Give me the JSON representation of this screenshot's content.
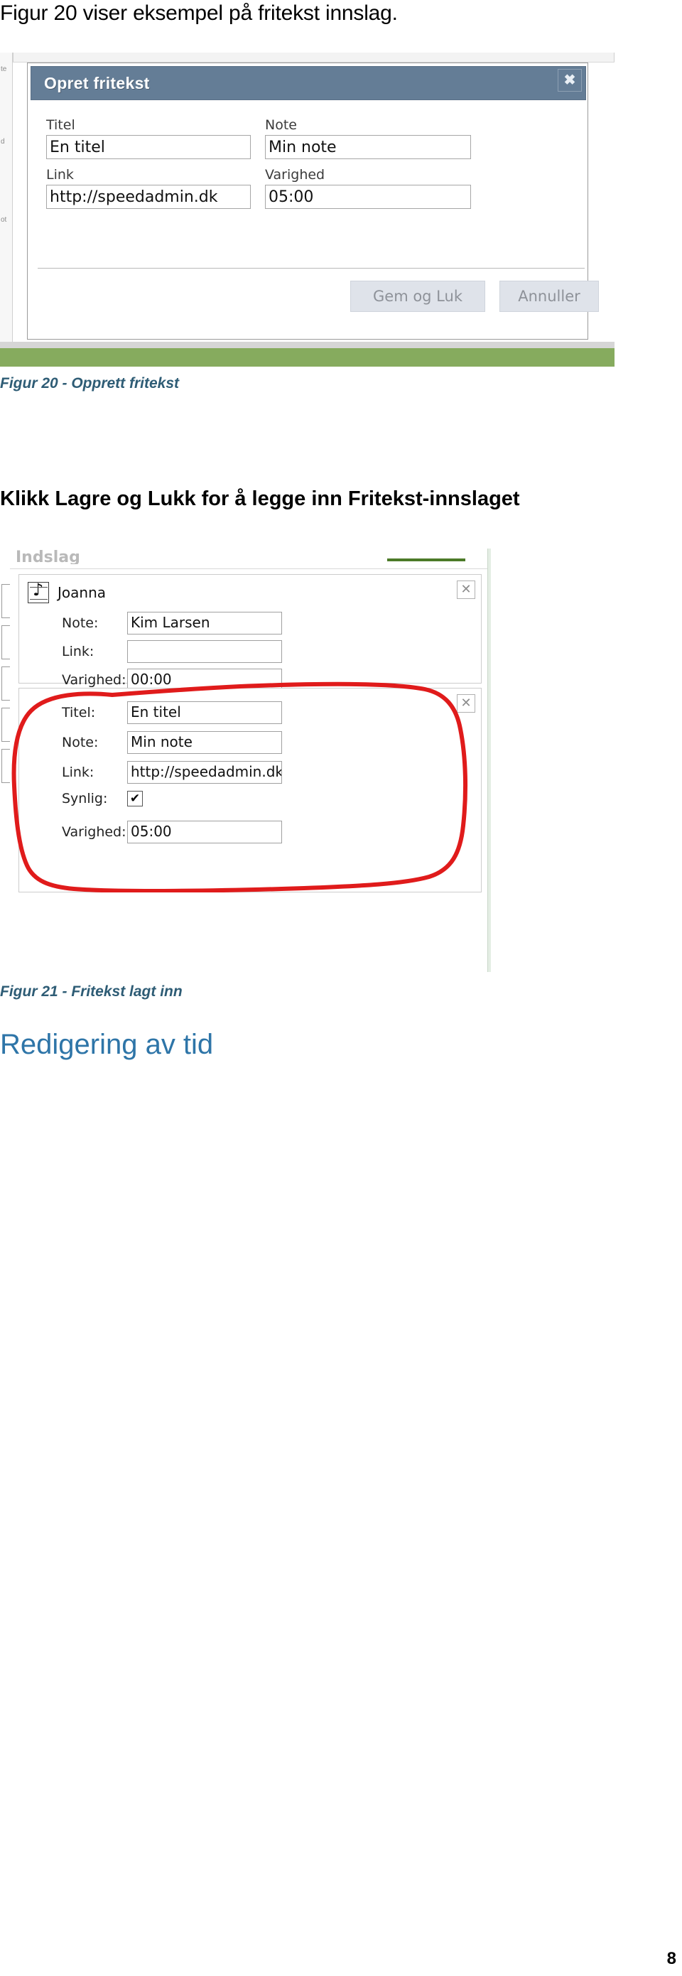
{
  "document": {
    "intro_paragraph": "Figur 20 viser eksempel på fritekst innslag.",
    "bold_instruction": "Klikk Lagre og Lukk for å legge inn Fritekst-innslaget",
    "caption_figur_20": "Figur 20 - Opprett fritekst",
    "caption_figur_21": "Figur 21 - Fritekst lagt inn",
    "heading_redigering": "Redigering av tid",
    "page_number": "8",
    "colors": {
      "caption": "#2e5c75",
      "heading": "#2e75a8",
      "dialog_titlebar": "#647d96",
      "green_bar": "#86ab5e",
      "annotation_red": "#e01b1b"
    }
  },
  "figure20": {
    "gutter_labels": [
      "te",
      "d",
      "ot"
    ],
    "dialog": {
      "title": "Opret fritekst",
      "close_icon": "close-icon",
      "close_glyph": "✖",
      "fields": [
        {
          "label": "Titel",
          "value": "En titel"
        },
        {
          "label": "Note",
          "value": "Min note"
        },
        {
          "label": "Link",
          "value": "http://speedadmin.dk"
        },
        {
          "label": "Varighed",
          "value": "05:00"
        }
      ],
      "buttons": [
        {
          "label": "Gem og Luk"
        },
        {
          "label": "Annuller"
        }
      ]
    }
  },
  "figure21": {
    "faded_header": "Indslag",
    "cards": [
      {
        "header_title": "Joanna",
        "header_icon": "music-note-icon",
        "close_glyph": "✕",
        "rows": [
          {
            "label": "Note:",
            "value": "Kim Larsen",
            "type": "text"
          },
          {
            "label": "Link:",
            "value": "",
            "type": "text"
          },
          {
            "label": "Varighed:",
            "value": "00:00",
            "type": "text"
          }
        ]
      },
      {
        "header_title": "",
        "close_glyph": "✕",
        "rows": [
          {
            "label": "Titel:",
            "value": "En titel",
            "type": "text"
          },
          {
            "label": "Note:",
            "value": "Min note",
            "type": "text"
          },
          {
            "label": "Link:",
            "value": "http://speedadmin.dk",
            "type": "text"
          },
          {
            "label": "Synlig:",
            "value": "✔",
            "type": "checkbox"
          },
          {
            "label": "Varighed:",
            "value": "05:00",
            "type": "text"
          }
        ]
      }
    ],
    "annotation": {
      "name": "red-highlight-circle",
      "shape": "hand-drawn-oval"
    }
  }
}
